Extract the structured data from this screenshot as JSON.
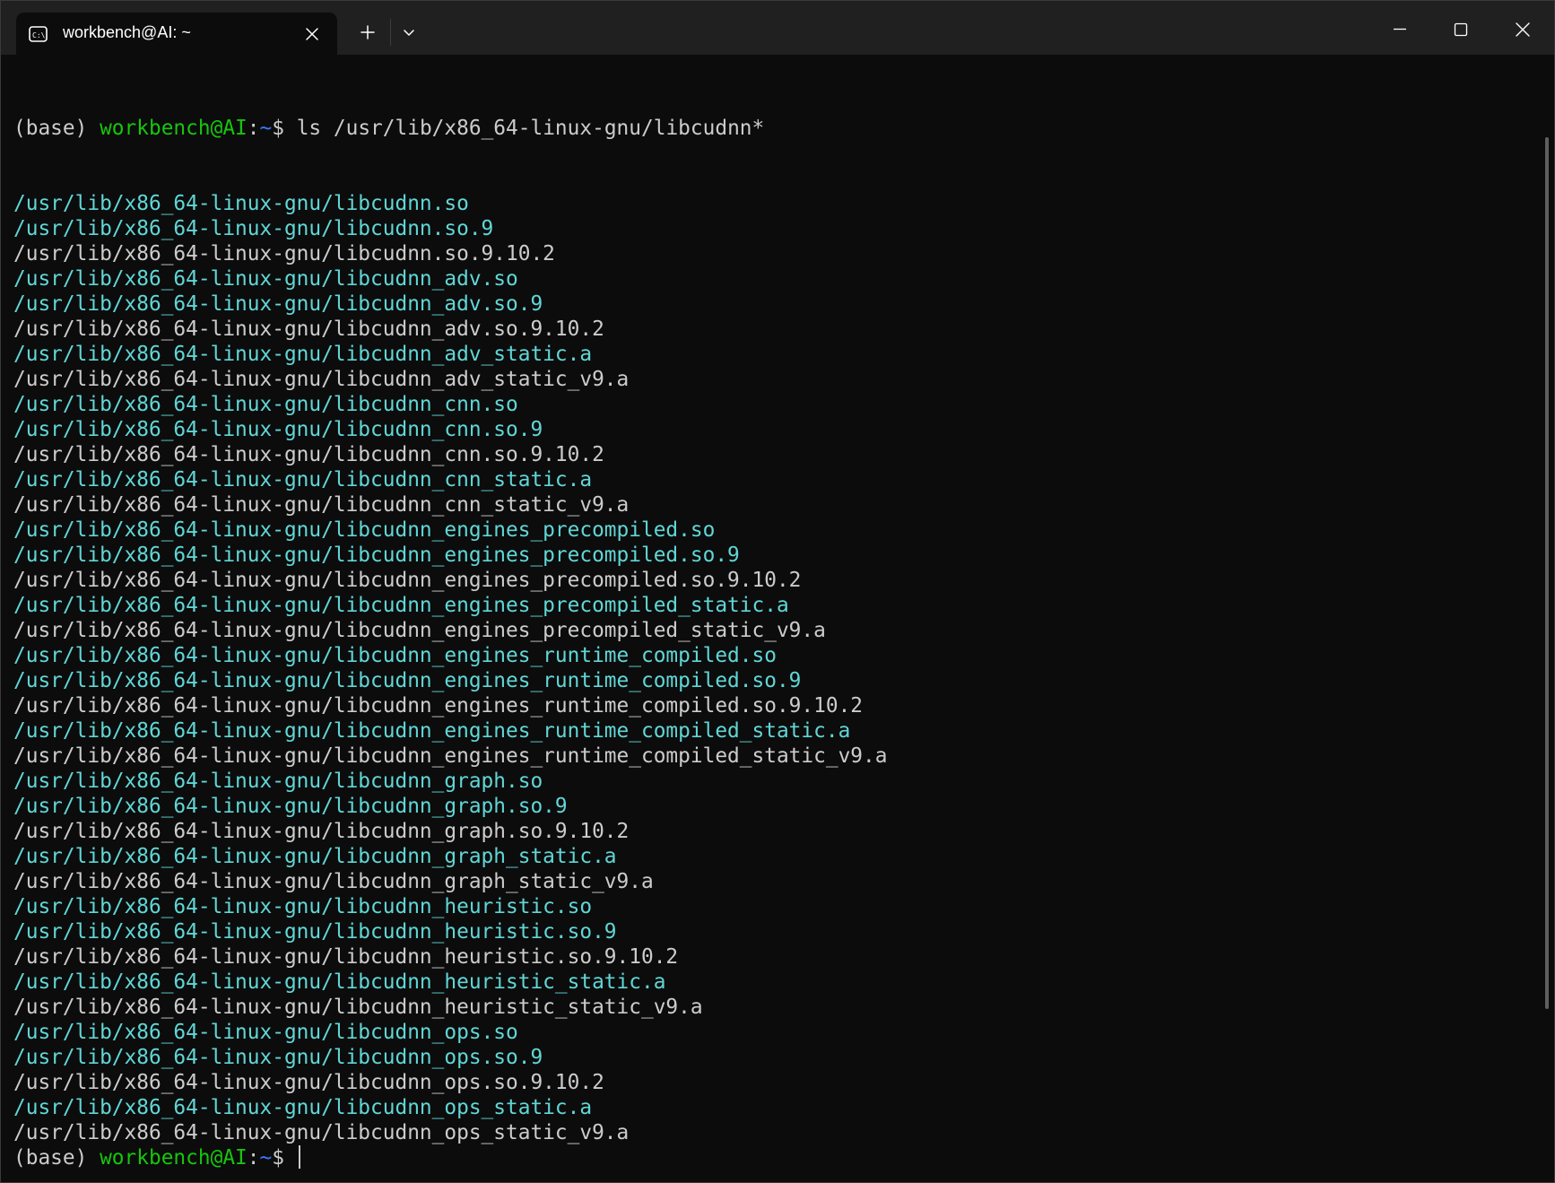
{
  "window": {
    "tab_title": "workbench@AI: ~",
    "tab_icon": "terminal-icon",
    "new_tab_icon": "plus-icon",
    "dropdown_icon": "chevron-down-icon",
    "minimize_icon": "minimize-icon",
    "maximize_icon": "maximize-icon",
    "close_icon": "close-icon"
  },
  "colors": {
    "background": "#0c0c0c",
    "titlebar": "#202020",
    "text": "#cccccc",
    "symlink": "#61d6d6",
    "prompt_user": "#16c60c",
    "prompt_path": "#3b78ff"
  },
  "prompt": {
    "env": "(base) ",
    "user_host": "workbench@AI",
    "sep": ":",
    "path": "~",
    "dollar": "$ "
  },
  "command": "ls /usr/lib/x86_64-linux-gnu/libcudnn*",
  "output": [
    {
      "text": "/usr/lib/x86_64-linux-gnu/libcudnn.so",
      "kind": "link"
    },
    {
      "text": "/usr/lib/x86_64-linux-gnu/libcudnn.so.9",
      "kind": "link"
    },
    {
      "text": "/usr/lib/x86_64-linux-gnu/libcudnn.so.9.10.2",
      "kind": "file"
    },
    {
      "text": "/usr/lib/x86_64-linux-gnu/libcudnn_adv.so",
      "kind": "link"
    },
    {
      "text": "/usr/lib/x86_64-linux-gnu/libcudnn_adv.so.9",
      "kind": "link"
    },
    {
      "text": "/usr/lib/x86_64-linux-gnu/libcudnn_adv.so.9.10.2",
      "kind": "file"
    },
    {
      "text": "/usr/lib/x86_64-linux-gnu/libcudnn_adv_static.a",
      "kind": "link"
    },
    {
      "text": "/usr/lib/x86_64-linux-gnu/libcudnn_adv_static_v9.a",
      "kind": "file"
    },
    {
      "text": "/usr/lib/x86_64-linux-gnu/libcudnn_cnn.so",
      "kind": "link"
    },
    {
      "text": "/usr/lib/x86_64-linux-gnu/libcudnn_cnn.so.9",
      "kind": "link"
    },
    {
      "text": "/usr/lib/x86_64-linux-gnu/libcudnn_cnn.so.9.10.2",
      "kind": "file"
    },
    {
      "text": "/usr/lib/x86_64-linux-gnu/libcudnn_cnn_static.a",
      "kind": "link"
    },
    {
      "text": "/usr/lib/x86_64-linux-gnu/libcudnn_cnn_static_v9.a",
      "kind": "file"
    },
    {
      "text": "/usr/lib/x86_64-linux-gnu/libcudnn_engines_precompiled.so",
      "kind": "link"
    },
    {
      "text": "/usr/lib/x86_64-linux-gnu/libcudnn_engines_precompiled.so.9",
      "kind": "link"
    },
    {
      "text": "/usr/lib/x86_64-linux-gnu/libcudnn_engines_precompiled.so.9.10.2",
      "kind": "file"
    },
    {
      "text": "/usr/lib/x86_64-linux-gnu/libcudnn_engines_precompiled_static.a",
      "kind": "link"
    },
    {
      "text": "/usr/lib/x86_64-linux-gnu/libcudnn_engines_precompiled_static_v9.a",
      "kind": "file"
    },
    {
      "text": "/usr/lib/x86_64-linux-gnu/libcudnn_engines_runtime_compiled.so",
      "kind": "link"
    },
    {
      "text": "/usr/lib/x86_64-linux-gnu/libcudnn_engines_runtime_compiled.so.9",
      "kind": "link"
    },
    {
      "text": "/usr/lib/x86_64-linux-gnu/libcudnn_engines_runtime_compiled.so.9.10.2",
      "kind": "file"
    },
    {
      "text": "/usr/lib/x86_64-linux-gnu/libcudnn_engines_runtime_compiled_static.a",
      "kind": "link"
    },
    {
      "text": "/usr/lib/x86_64-linux-gnu/libcudnn_engines_runtime_compiled_static_v9.a",
      "kind": "file"
    },
    {
      "text": "/usr/lib/x86_64-linux-gnu/libcudnn_graph.so",
      "kind": "link"
    },
    {
      "text": "/usr/lib/x86_64-linux-gnu/libcudnn_graph.so.9",
      "kind": "link"
    },
    {
      "text": "/usr/lib/x86_64-linux-gnu/libcudnn_graph.so.9.10.2",
      "kind": "file"
    },
    {
      "text": "/usr/lib/x86_64-linux-gnu/libcudnn_graph_static.a",
      "kind": "link"
    },
    {
      "text": "/usr/lib/x86_64-linux-gnu/libcudnn_graph_static_v9.a",
      "kind": "file"
    },
    {
      "text": "/usr/lib/x86_64-linux-gnu/libcudnn_heuristic.so",
      "kind": "link"
    },
    {
      "text": "/usr/lib/x86_64-linux-gnu/libcudnn_heuristic.so.9",
      "kind": "link"
    },
    {
      "text": "/usr/lib/x86_64-linux-gnu/libcudnn_heuristic.so.9.10.2",
      "kind": "file"
    },
    {
      "text": "/usr/lib/x86_64-linux-gnu/libcudnn_heuristic_static.a",
      "kind": "link"
    },
    {
      "text": "/usr/lib/x86_64-linux-gnu/libcudnn_heuristic_static_v9.a",
      "kind": "file"
    },
    {
      "text": "/usr/lib/x86_64-linux-gnu/libcudnn_ops.so",
      "kind": "link"
    },
    {
      "text": "/usr/lib/x86_64-linux-gnu/libcudnn_ops.so.9",
      "kind": "link"
    },
    {
      "text": "/usr/lib/x86_64-linux-gnu/libcudnn_ops.so.9.10.2",
      "kind": "file"
    },
    {
      "text": "/usr/lib/x86_64-linux-gnu/libcudnn_ops_static.a",
      "kind": "link"
    },
    {
      "text": "/usr/lib/x86_64-linux-gnu/libcudnn_ops_static_v9.a",
      "kind": "file"
    }
  ]
}
